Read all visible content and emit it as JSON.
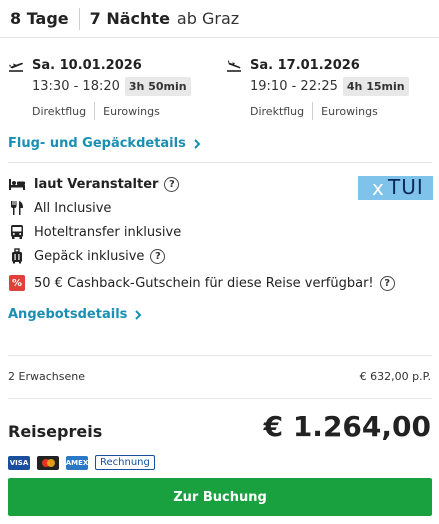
{
  "header": {
    "days": "8 Tage",
    "nights": "7 Nächte",
    "origin": "ab Graz"
  },
  "outbound": {
    "date": "Sa. 10.01.2026",
    "times": "13:30 - 18:20",
    "duration": "3h 50min",
    "type": "Direktflug",
    "airline": "Eurowings",
    "icon": "plane-departure-icon"
  },
  "inbound": {
    "date": "Sa. 17.01.2026",
    "times": "19:10 - 22:25",
    "duration": "4h 15min",
    "type": "Direktflug",
    "airline": "Eurowings",
    "icon": "plane-arrival-icon"
  },
  "flight_details_link": "Flug- und Gepäckdetails",
  "features": {
    "room": "laut Veranstalter",
    "board": "All Inclusive",
    "transfer": "Hoteltransfer inklusive",
    "luggage": "Gepäck inklusive",
    "cashback_badge": "%",
    "cashback": "50 € Cashback-Gutschein für diese Reise verfügbar!"
  },
  "operator_logo": {
    "text": "TUI",
    "color": "#7fc2ea"
  },
  "offer_details_link": "Angebotsdetails",
  "passengers": {
    "label": "2 Erwachsene",
    "per_person": "€ 632,00 p.P."
  },
  "total": {
    "label": "Reisepreis",
    "price": "€ 1.264,00"
  },
  "payment": {
    "visa": "VISA",
    "amex": "AMEX",
    "invoice": "Rechnung"
  },
  "book_button": "Zur Buchung",
  "colors": {
    "link": "#1b8fb3",
    "book": "#1aa13f",
    "badge": "#e0403a"
  }
}
